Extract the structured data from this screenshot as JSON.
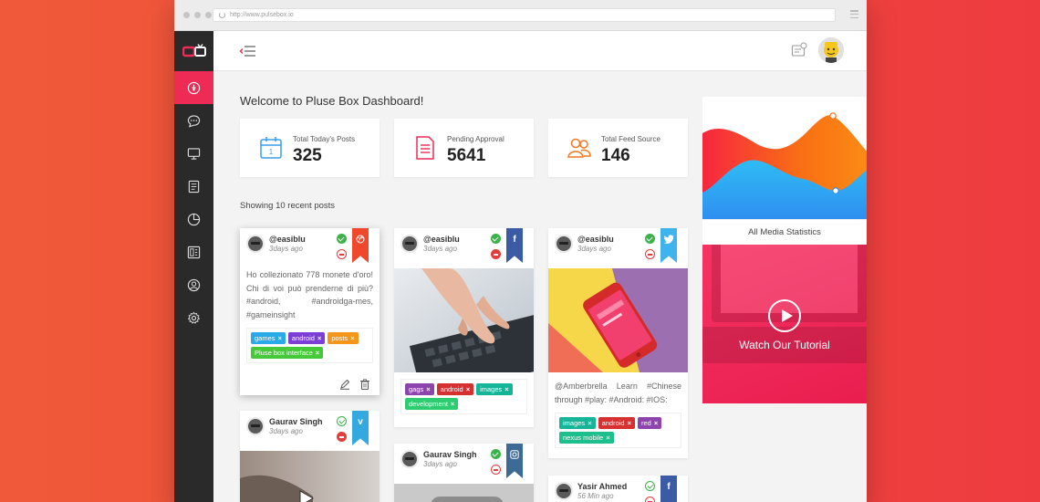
{
  "browser": {
    "url": "http://www.pulsebox.io"
  },
  "main": {
    "welcome": "Welcome to Pluse Box Dashboard!",
    "stats": [
      {
        "label": "Total Today's Posts",
        "value": "325",
        "color": "#3a9ee6"
      },
      {
        "label": "Pending Approval",
        "value": "5641",
        "color": "#ee2b55"
      },
      {
        "label": "Total Feed Source",
        "value": "146",
        "color": "#f5781e"
      }
    ],
    "showing": "Showing 10 recent posts"
  },
  "posts": [
    {
      "user": "@easiblu",
      "time": "3days ago",
      "network": "dribbble-icon",
      "ribbon_color": "#f0482d",
      "text": "Ho collezionato 778 monete d'oro! Chi di voi può prenderne di più? #android, #androidga-mes, #gameinsight",
      "tags": [
        {
          "label": "games",
          "color": "#29a9e8"
        },
        {
          "label": "android",
          "color": "#7b3fd6"
        },
        {
          "label": "posts",
          "color": "#f5961b"
        },
        {
          "label": "Pluse box interface",
          "color": "#46c938"
        }
      ]
    },
    {
      "user": "@easiblu",
      "time": "3days ago",
      "network": "facebook-icon",
      "ribbon_color": "#3b5ba5",
      "ribbon_glyph": "f",
      "tags": [
        {
          "label": "gags",
          "color": "#8e44ad"
        },
        {
          "label": "android",
          "color": "#d63031"
        },
        {
          "label": "images",
          "color": "#16b59a"
        },
        {
          "label": "development",
          "color": "#2ecc71"
        }
      ]
    },
    {
      "user": "@easiblu",
      "time": "3days ago",
      "network": "twitter-icon",
      "ribbon_color": "#3fb3ec",
      "text": "@Amberbrella Learn #Chinese through #play: #Android: #IOS:",
      "tags": [
        {
          "label": "images",
          "color": "#16b59a"
        },
        {
          "label": "android",
          "color": "#d63031"
        },
        {
          "label": "red",
          "color": "#8e44ad"
        },
        {
          "label": "nexus mobile",
          "color": "#1dbf8c"
        }
      ]
    },
    {
      "user": "Gaurav Singh",
      "time": "3days ago",
      "network": "vimeo-icon",
      "ribbon_color": "#33a9e0",
      "ribbon_glyph": "v"
    },
    {
      "user": "Gaurav Singh",
      "time": "3days ago",
      "network": "instagram-icon",
      "ribbon_color": "#3d6b95"
    },
    {
      "user": "Yasir Ahmed",
      "time": "56 Min ago",
      "network": "facebook-icon",
      "ribbon_color": "#3b5ba5",
      "ribbon_glyph": "f"
    }
  ],
  "right_panel": {
    "stats_label": "All Media Statistics",
    "tutorial_label": "Watch Our Tutorial"
  },
  "sidebar_icons": [
    "dashboard-icon",
    "chat-icon",
    "monitor-icon",
    "document-icon",
    "pie-chart-icon",
    "layout-icon",
    "user-icon",
    "settings-icon"
  ]
}
